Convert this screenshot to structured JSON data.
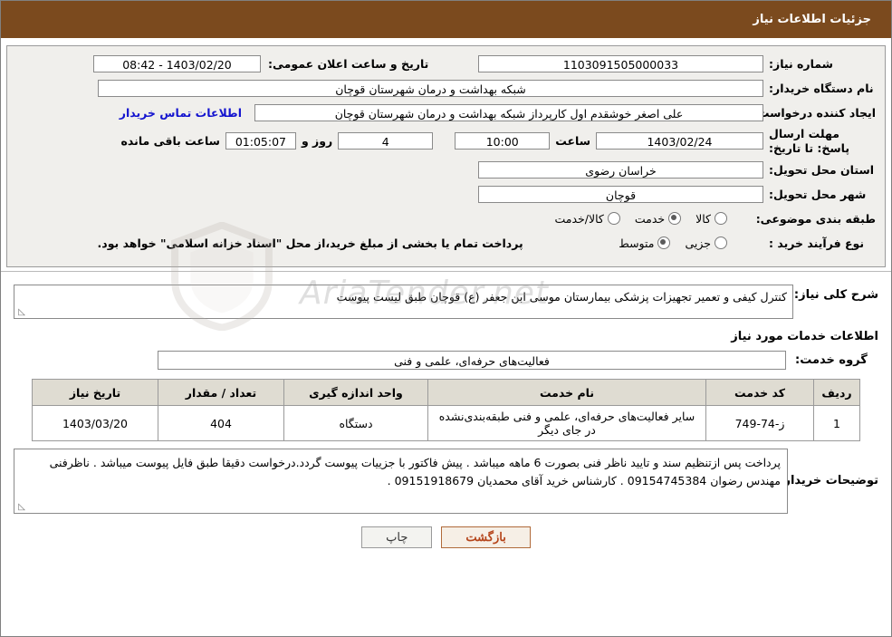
{
  "header": {
    "title": "جزئیات اطلاعات نیاز"
  },
  "info": {
    "need_number_label": "شماره نیاز:",
    "need_number_value": "1103091505000033",
    "announce_date_label": "تاریخ و ساعت اعلان عمومی:",
    "announce_date_value": "1403/02/20 - 08:42",
    "buyer_org_label": "نام دستگاه خریدار:",
    "buyer_org_value": "شبکه بهداشت و درمان شهرستان قوچان",
    "requester_label": "ایجاد کننده درخواست:",
    "requester_value": "علی اصغر خوشقدم اول کارپرداز شبکه بهداشت و درمان شهرستان قوچان",
    "contact_link": "اطلاعات تماس خریدار",
    "deadline_label": "مهلت ارسال پاسخ: تا تاریخ:",
    "deadline_date": "1403/02/24",
    "hour_label": "ساعت",
    "deadline_time": "10:00",
    "days_value": "4",
    "days_label": "روز و",
    "remaining_time": "01:05:07",
    "remaining_label": "ساعت باقی مانده",
    "province_label": "استان محل تحویل:",
    "province_value": "خراسان رضوی",
    "city_label": "شهر محل تحویل:",
    "city_value": "قوچان",
    "category_label": "طبقه بندی موضوعی:",
    "category_options": [
      {
        "label": "کالا",
        "selected": false
      },
      {
        "label": "خدمت",
        "selected": true
      },
      {
        "label": "کالا/خدمت",
        "selected": false
      }
    ],
    "process_label": "نوع فرآیند خرید :",
    "process_options": [
      {
        "label": "جزیی",
        "selected": false
      },
      {
        "label": "متوسط",
        "selected": true
      }
    ],
    "process_note": "پرداخت تمام یا بخشی از مبلغ خرید،از محل \"اسناد خزانه اسلامی\" خواهد بود."
  },
  "watermark": {
    "text": "AriaTender.net"
  },
  "general": {
    "sharh_label": "شرح کلی نیاز:",
    "sharh_value": "کنترل کیفی و تعمیر تجهیزات پزشکی بیمارستان موسی ابن جعفر (ع) قوچان طبق لیست پیوست",
    "services_section_title": "اطلاعات خدمات مورد نیاز",
    "service_group_label": "گروه خدمت:",
    "service_group_value": "فعالیت‌های حرفه‌ای، علمی و فنی"
  },
  "table": {
    "headers": [
      "ردیف",
      "کد خدمت",
      "نام خدمت",
      "واحد اندازه گیری",
      "تعداد / مقدار",
      "تاریخ نیاز"
    ],
    "rows": [
      {
        "row": "1",
        "code": "ز-74-749",
        "name": "سایر فعالیت‌های حرفه‌ای، علمی و فنی طبقه‌بندی‌نشده در جای دیگر",
        "unit": "دستگاه",
        "qty": "404",
        "date": "1403/03/20"
      }
    ]
  },
  "notes": {
    "label": "توضیحات خریدار:",
    "value": "پرداخت پس ازتنظیم سند و تایید ناظر فنی بصورت 6 ماهه میباشد . پیش فاکتور با جزییات پیوست گردد.درخواست دقیقا طبق فایل پیوست میباشد . ناظرفنی مهندس رضوان 09154745384 . کارشناس خرید آقای محمدیان 09151918679 ."
  },
  "buttons": {
    "back": "بازگشت",
    "print": "چاپ"
  },
  "colors": {
    "header_bg": "#7B4A1E",
    "panel_bg": "#f0efec",
    "link": "#1414cf",
    "accent_btn": "#b5451b"
  }
}
